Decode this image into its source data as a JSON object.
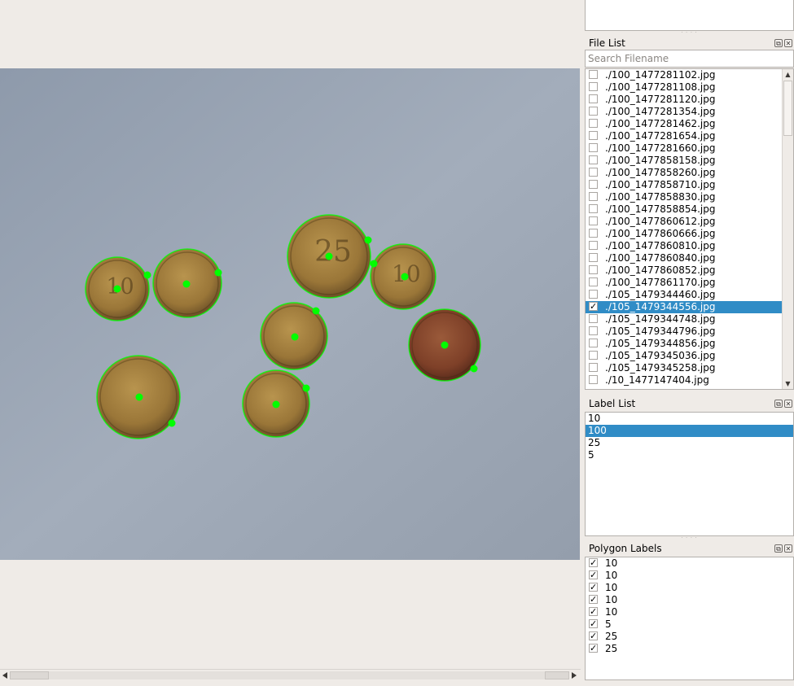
{
  "colors": {
    "accent": "#308cc6",
    "polygon": "#00ff00",
    "window_bg": "#efebe7"
  },
  "top_list": {
    "items": []
  },
  "file_list": {
    "title": "File List",
    "search_placeholder": "Search Filename",
    "files": [
      {
        "name": "./100_1477281102.jpg",
        "checked": false
      },
      {
        "name": "./100_1477281108.jpg",
        "checked": false
      },
      {
        "name": "./100_1477281120.jpg",
        "checked": false
      },
      {
        "name": "./100_1477281354.jpg",
        "checked": false
      },
      {
        "name": "./100_1477281462.jpg",
        "checked": false
      },
      {
        "name": "./100_1477281654.jpg",
        "checked": false
      },
      {
        "name": "./100_1477281660.jpg",
        "checked": false
      },
      {
        "name": "./100_1477858158.jpg",
        "checked": false
      },
      {
        "name": "./100_1477858260.jpg",
        "checked": false
      },
      {
        "name": "./100_1477858710.jpg",
        "checked": false
      },
      {
        "name": "./100_1477858830.jpg",
        "checked": false
      },
      {
        "name": "./100_1477858854.jpg",
        "checked": false
      },
      {
        "name": "./100_1477860612.jpg",
        "checked": false
      },
      {
        "name": "./100_1477860666.jpg",
        "checked": false
      },
      {
        "name": "./100_1477860810.jpg",
        "checked": false
      },
      {
        "name": "./100_1477860840.jpg",
        "checked": false
      },
      {
        "name": "./100_1477860852.jpg",
        "checked": false
      },
      {
        "name": "./100_1477861170.jpg",
        "checked": false
      },
      {
        "name": "./105_1479344460.jpg",
        "checked": false
      },
      {
        "name": "./105_1479344556.jpg",
        "checked": true,
        "selected": true
      },
      {
        "name": "./105_1479344748.jpg",
        "checked": false
      },
      {
        "name": "./105_1479344796.jpg",
        "checked": false
      },
      {
        "name": "./105_1479344856.jpg",
        "checked": false
      },
      {
        "name": "./105_1479345036.jpg",
        "checked": false
      },
      {
        "name": "./105_1479345258.jpg",
        "checked": false
      },
      {
        "name": "./10_1477147404.jpg",
        "checked": false
      }
    ]
  },
  "label_list": {
    "title": "Label List",
    "labels": [
      {
        "name": "10",
        "selected": false
      },
      {
        "name": "100",
        "selected": true
      },
      {
        "name": "25",
        "selected": false
      },
      {
        "name": "5",
        "selected": false
      }
    ]
  },
  "polygon_labels": {
    "title": "Polygon Labels",
    "items": [
      {
        "name": "10",
        "checked": true
      },
      {
        "name": "10",
        "checked": true
      },
      {
        "name": "10",
        "checked": true
      },
      {
        "name": "10",
        "checked": true
      },
      {
        "name": "10",
        "checked": true
      },
      {
        "name": "5",
        "checked": true
      },
      {
        "name": "25",
        "checked": true
      },
      {
        "name": "25",
        "checked": true
      }
    ]
  },
  "canvas": {
    "coins": [
      {
        "label": "10",
        "engraving": "10"
      },
      {
        "label": "10",
        "engraving": ""
      },
      {
        "label": "25",
        "engraving": "25"
      },
      {
        "label": "10",
        "engraving": "10"
      },
      {
        "label": "10",
        "engraving": ""
      },
      {
        "label": "5",
        "engraving": ""
      },
      {
        "label": "25",
        "engraving": ""
      },
      {
        "label": "10",
        "engraving": ""
      }
    ]
  }
}
